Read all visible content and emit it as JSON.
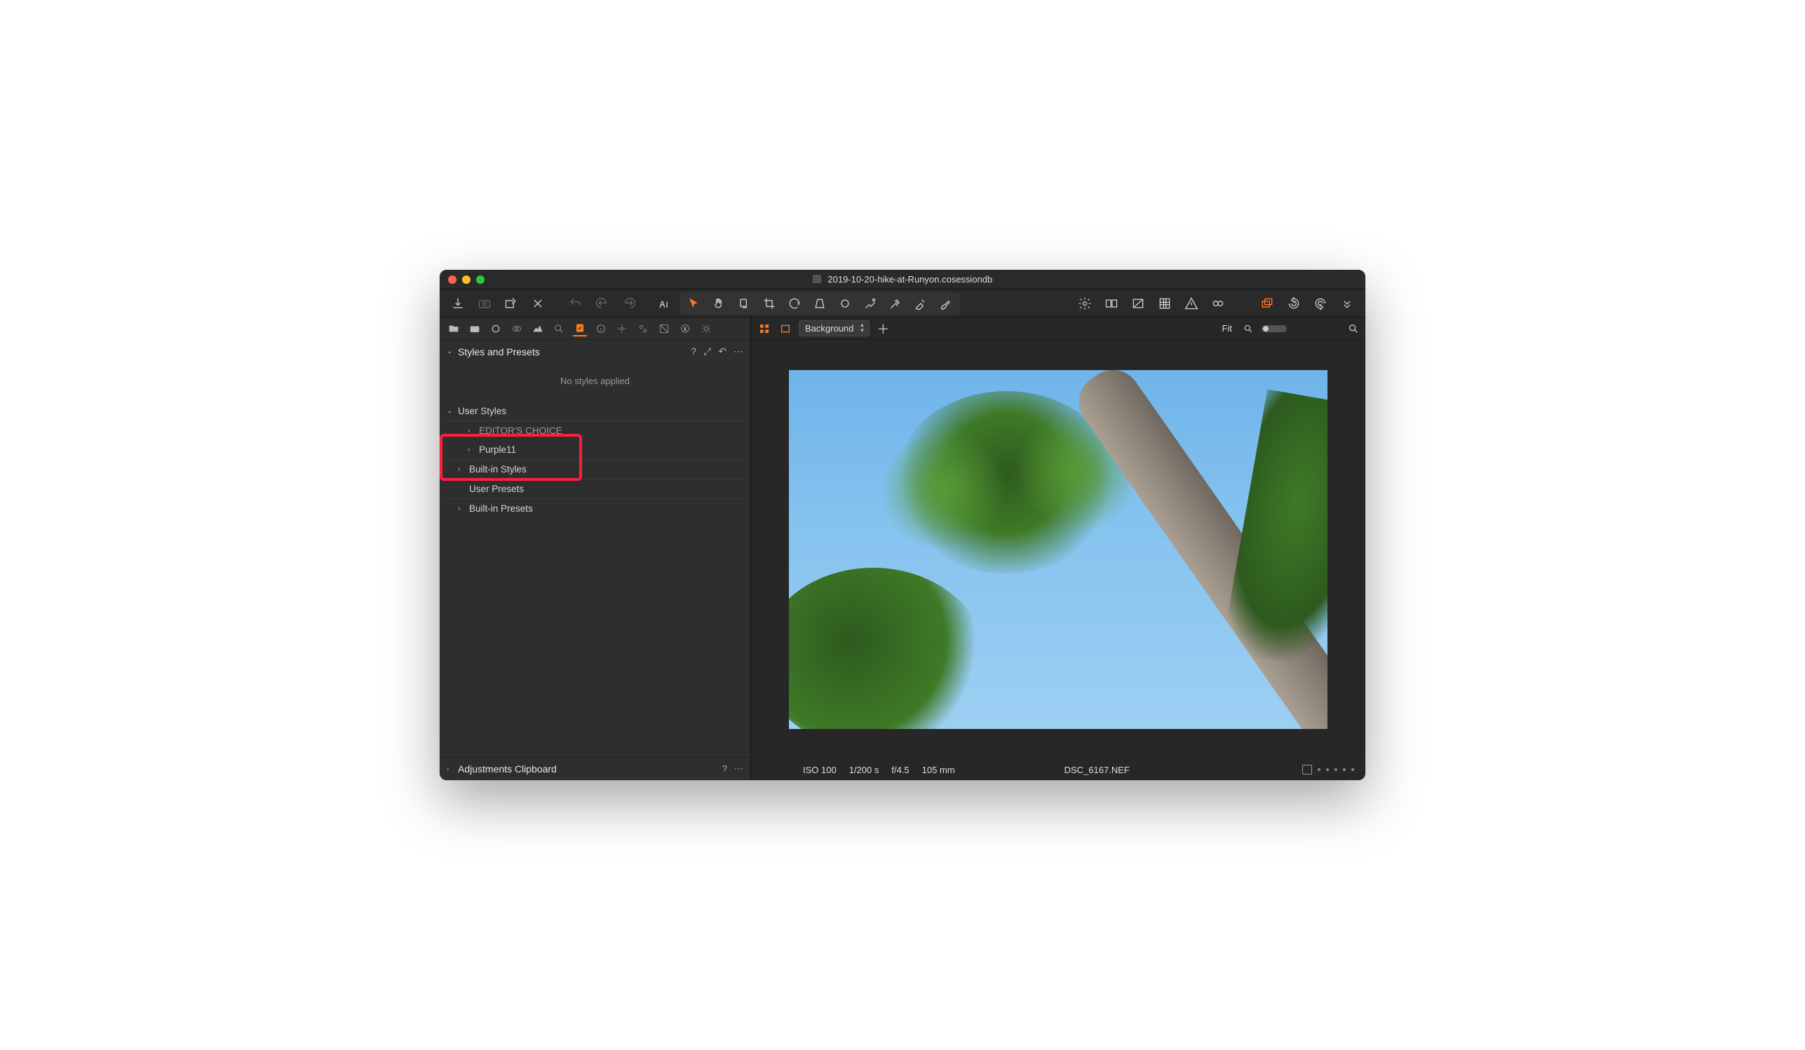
{
  "window": {
    "title": "2019-10-20-hike-at-Runyon.cosessiondb"
  },
  "toolbar": {
    "left_icons": [
      "import",
      "camera",
      "folder-export",
      "close",
      "undo-curve",
      "undo",
      "redo",
      "annotation"
    ],
    "cursor_group": [
      "cursor",
      "hand",
      "mask",
      "crop",
      "rotate",
      "keystone",
      "ring",
      "heal",
      "picker",
      "brush-minus",
      "eraser"
    ],
    "right_icons": [
      "gear",
      "grid-before-after",
      "focus-overlay",
      "grid",
      "warning",
      "glasses"
    ],
    "far_right": [
      "copies",
      "reset-ccw",
      "reset-cw",
      "more"
    ]
  },
  "tooltabs": [
    "folder",
    "camera",
    "ring",
    "link",
    "histogram",
    "search",
    "checkbox",
    "info",
    "settings",
    "gears",
    "exposure",
    "channel",
    "adjust"
  ],
  "panel": {
    "title": "Styles and Presets",
    "help": "?",
    "empty": "No styles applied",
    "tree": {
      "user_styles": "User Styles",
      "editors_choice": "EDITOR'S CHOICE",
      "purple11": "Purple11",
      "builtin_styles": "Built-in Styles",
      "user_presets": "User Presets",
      "builtin_presets": "Built-in Presets"
    }
  },
  "bottom_panel": {
    "title": "Adjustments Clipboard",
    "help": "?"
  },
  "viewer": {
    "bg_label": "Background",
    "fit_label": "Fit"
  },
  "meta": {
    "iso": "ISO 100",
    "shutter": "1/200 s",
    "aperture": "f/4.5",
    "focal": "105 mm",
    "filename": "DSC_6167.NEF"
  }
}
